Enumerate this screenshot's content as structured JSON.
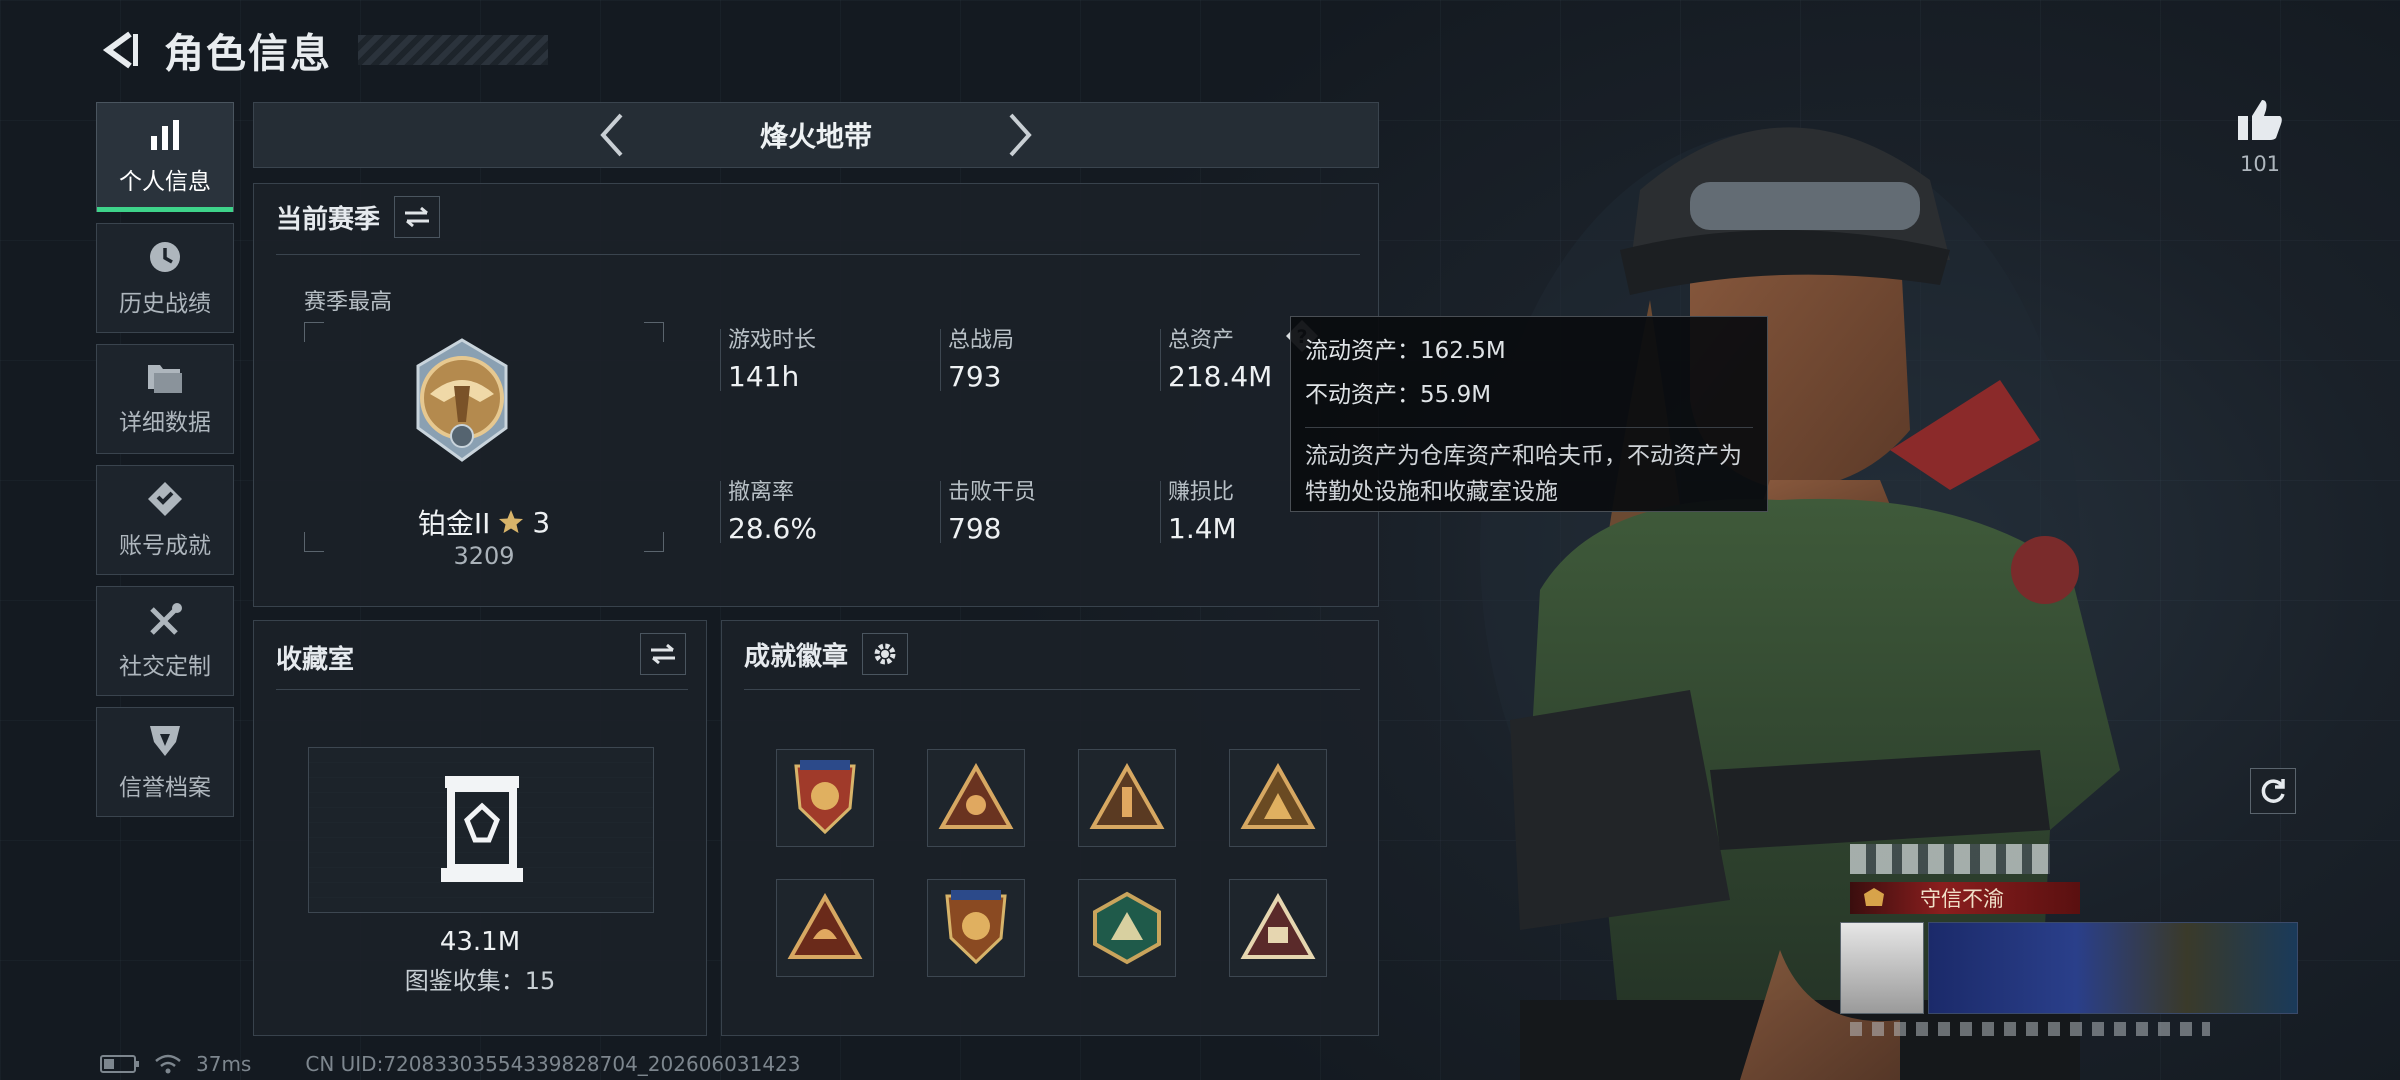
{
  "header": {
    "title": "角色信息"
  },
  "sidebar": {
    "items": [
      {
        "label": "个人信息",
        "icon": "bar-chart-icon",
        "active": true
      },
      {
        "label": "历史战绩",
        "icon": "clock-icon",
        "active": false
      },
      {
        "label": "详细数据",
        "icon": "folder-icon",
        "active": false
      },
      {
        "label": "账号成就",
        "icon": "achievement-icon",
        "active": false
      },
      {
        "label": "社交定制",
        "icon": "wrench-icon",
        "active": false
      },
      {
        "label": "信誉档案",
        "icon": "shield-icon",
        "active": false
      }
    ]
  },
  "mode": {
    "title": "烽火地带"
  },
  "season": {
    "title": "当前赛季",
    "best_label": "赛季最高",
    "rank_name": "铂金II",
    "rank_stars": "3",
    "rank_score": "3209",
    "stats": [
      {
        "label": "游戏时长",
        "value": "141h"
      },
      {
        "label": "总战局",
        "value": "793"
      },
      {
        "label": "总资产",
        "value": "218.4M"
      },
      {
        "label": "撤离率",
        "value": "28.6%"
      },
      {
        "label": "击败干员",
        "value": "798"
      },
      {
        "label": "赚损比",
        "value": "1.4M"
      }
    ]
  },
  "tooltip": {
    "line1": "流动资产：162.5M",
    "line2": "不动资产：55.9M",
    "desc": "流动资产为仓库资产和哈夫币，不动资产为特勤处设施和收藏室设施"
  },
  "collection": {
    "title": "收藏室",
    "value": "43.1M",
    "gallery": "图鉴收集：15"
  },
  "achievements": {
    "title": "成就徽章",
    "badge_count": 8
  },
  "player": {
    "title_badge": "守信不渝"
  },
  "likes": {
    "count": "101"
  },
  "footer": {
    "ping": "37ms",
    "uid": "CN UID:72083303554339828704_202606031423"
  },
  "colors": {
    "accent": "#3ed38a",
    "gold": "#c9a45c",
    "title_badge_bg": "#8b1e1e"
  }
}
